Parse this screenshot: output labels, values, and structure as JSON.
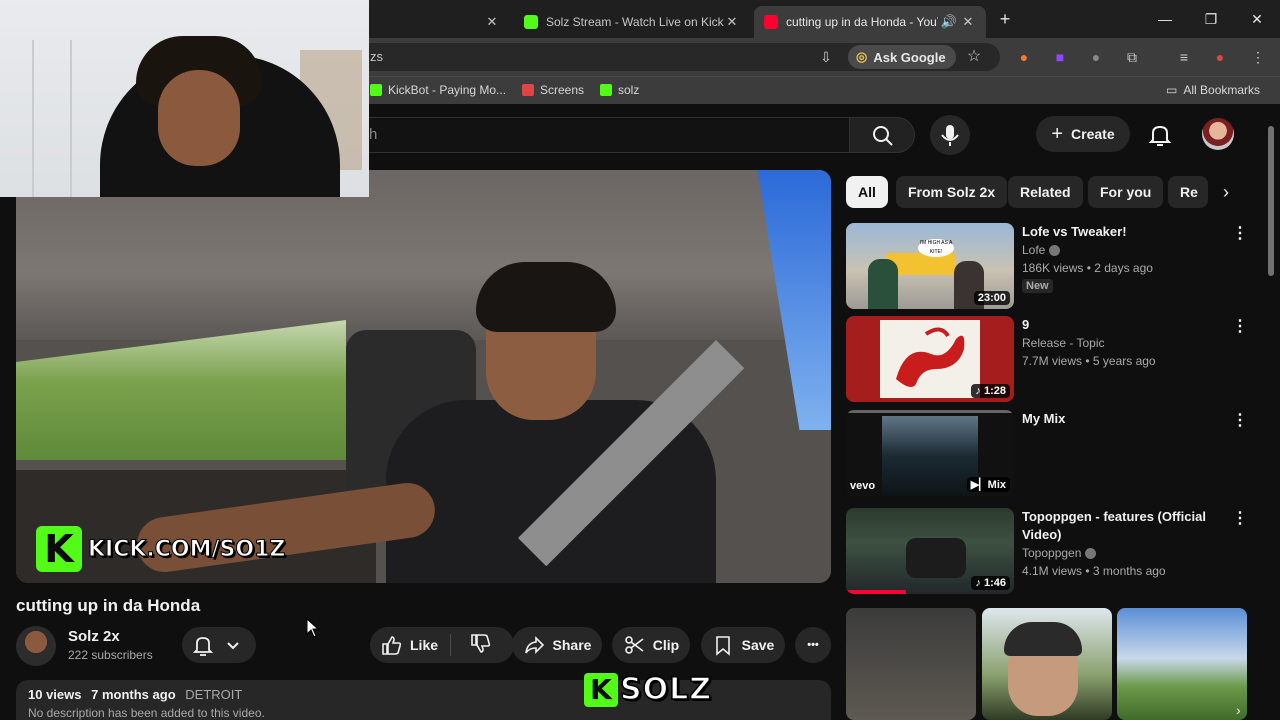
{
  "browser": {
    "tabs": [
      {
        "title": "",
        "active": false
      },
      {
        "title": "Solz Stream - Watch Live on Kick",
        "active": false
      },
      {
        "title": "cutting up in da Honda - YouTube",
        "active": true
      }
    ],
    "new_tab": "+",
    "window_controls": {
      "minimize": "—",
      "restore": "❐",
      "close": "✕"
    },
    "omnibox_text": "zs",
    "ask_google": "Ask Google",
    "bookmarks": [
      {
        "label": "KickBot - Paying Mo...",
        "icon": "kickbot-icon",
        "color": "#53fc18"
      },
      {
        "label": "Screens",
        "icon": "screens-icon",
        "color": "#e04545"
      },
      {
        "label": "solz",
        "icon": "kick-icon",
        "color": "#53fc18"
      }
    ],
    "all_bookmarks": "All Bookmarks"
  },
  "youtube": {
    "search_placeholder": "h",
    "create_label": "Create",
    "video": {
      "title": "cutting up in da Honda",
      "watermark": "KICK.COM/SO1Z",
      "watermark_logo": "K"
    },
    "channel": {
      "name": "Solz 2x",
      "subscribers": "222 subscribers"
    },
    "actions": {
      "like": "Like",
      "share": "Share",
      "clip": "Clip",
      "save": "Save",
      "more": "•••"
    },
    "description": {
      "views": "10 views",
      "age": "7 months ago",
      "tag": "DETROIT",
      "text": "No description has been added to this video."
    },
    "chips": [
      "All",
      "From Solz 2x",
      "Related",
      "For you",
      "Re"
    ],
    "recommendations": [
      {
        "title": "Lofe vs Tweaker!",
        "channel": "Lofe",
        "verified": true,
        "stats": "186K views • 2 days ago",
        "badge": "New",
        "duration": "23:00",
        "thumb_caption": "I'M HIGH AS A KITE!"
      },
      {
        "title": "9",
        "channel": "Release - Topic",
        "verified": false,
        "stats": "7.7M views • 5 years ago",
        "badge": "",
        "duration": "♪ 1:28",
        "thumb_caption": ""
      },
      {
        "title": "My Mix",
        "channel": "",
        "verified": false,
        "stats": "",
        "badge": "",
        "duration": "Mix",
        "thumb_caption": "vevo"
      },
      {
        "title": "Topoppgen - features (Official Video)",
        "channel": "Topoppgen",
        "verified": true,
        "stats": "4.1M views • 3 months ago",
        "badge": "",
        "duration": "♪ 1:46",
        "thumb_caption": ""
      }
    ]
  },
  "overlay": {
    "brand_logo": "K",
    "brand_text": "SOLZ"
  },
  "colors": {
    "kick_green": "#53fc18",
    "yt_red": "#ff0033",
    "bg": "#0f0f0f",
    "surface": "#272727"
  }
}
